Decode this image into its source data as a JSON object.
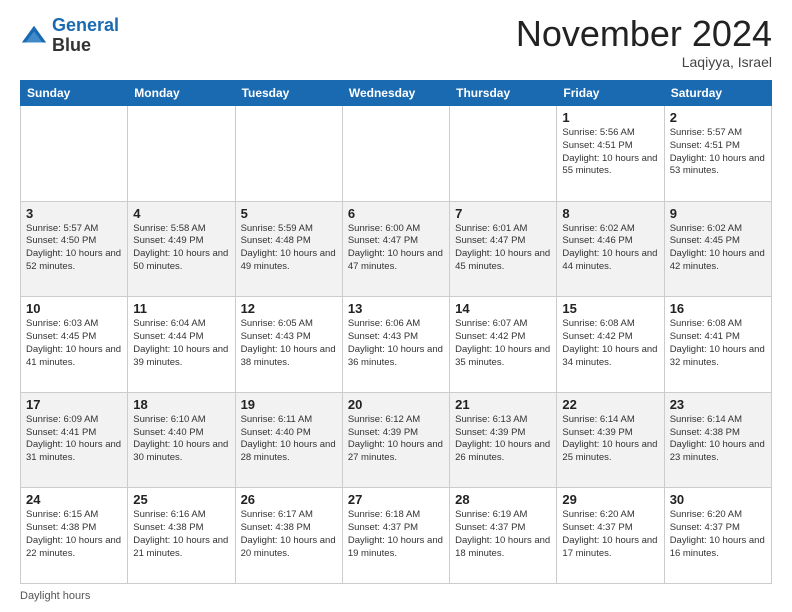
{
  "header": {
    "logo_line1": "General",
    "logo_line2": "Blue",
    "month": "November 2024",
    "location": "Laqiyya, Israel"
  },
  "footer": {
    "daylight_label": "Daylight hours"
  },
  "weekdays": [
    "Sunday",
    "Monday",
    "Tuesday",
    "Wednesday",
    "Thursday",
    "Friday",
    "Saturday"
  ],
  "weeks": [
    [
      {
        "day": "",
        "info": ""
      },
      {
        "day": "",
        "info": ""
      },
      {
        "day": "",
        "info": ""
      },
      {
        "day": "",
        "info": ""
      },
      {
        "day": "",
        "info": ""
      },
      {
        "day": "1",
        "info": "Sunrise: 5:56 AM\nSunset: 4:51 PM\nDaylight: 10 hours\nand 55 minutes."
      },
      {
        "day": "2",
        "info": "Sunrise: 5:57 AM\nSunset: 4:51 PM\nDaylight: 10 hours\nand 53 minutes."
      }
    ],
    [
      {
        "day": "3",
        "info": "Sunrise: 5:57 AM\nSunset: 4:50 PM\nDaylight: 10 hours\nand 52 minutes."
      },
      {
        "day": "4",
        "info": "Sunrise: 5:58 AM\nSunset: 4:49 PM\nDaylight: 10 hours\nand 50 minutes."
      },
      {
        "day": "5",
        "info": "Sunrise: 5:59 AM\nSunset: 4:48 PM\nDaylight: 10 hours\nand 49 minutes."
      },
      {
        "day": "6",
        "info": "Sunrise: 6:00 AM\nSunset: 4:47 PM\nDaylight: 10 hours\nand 47 minutes."
      },
      {
        "day": "7",
        "info": "Sunrise: 6:01 AM\nSunset: 4:47 PM\nDaylight: 10 hours\nand 45 minutes."
      },
      {
        "day": "8",
        "info": "Sunrise: 6:02 AM\nSunset: 4:46 PM\nDaylight: 10 hours\nand 44 minutes."
      },
      {
        "day": "9",
        "info": "Sunrise: 6:02 AM\nSunset: 4:45 PM\nDaylight: 10 hours\nand 42 minutes."
      }
    ],
    [
      {
        "day": "10",
        "info": "Sunrise: 6:03 AM\nSunset: 4:45 PM\nDaylight: 10 hours\nand 41 minutes."
      },
      {
        "day": "11",
        "info": "Sunrise: 6:04 AM\nSunset: 4:44 PM\nDaylight: 10 hours\nand 39 minutes."
      },
      {
        "day": "12",
        "info": "Sunrise: 6:05 AM\nSunset: 4:43 PM\nDaylight: 10 hours\nand 38 minutes."
      },
      {
        "day": "13",
        "info": "Sunrise: 6:06 AM\nSunset: 4:43 PM\nDaylight: 10 hours\nand 36 minutes."
      },
      {
        "day": "14",
        "info": "Sunrise: 6:07 AM\nSunset: 4:42 PM\nDaylight: 10 hours\nand 35 minutes."
      },
      {
        "day": "15",
        "info": "Sunrise: 6:08 AM\nSunset: 4:42 PM\nDaylight: 10 hours\nand 34 minutes."
      },
      {
        "day": "16",
        "info": "Sunrise: 6:08 AM\nSunset: 4:41 PM\nDaylight: 10 hours\nand 32 minutes."
      }
    ],
    [
      {
        "day": "17",
        "info": "Sunrise: 6:09 AM\nSunset: 4:41 PM\nDaylight: 10 hours\nand 31 minutes."
      },
      {
        "day": "18",
        "info": "Sunrise: 6:10 AM\nSunset: 4:40 PM\nDaylight: 10 hours\nand 30 minutes."
      },
      {
        "day": "19",
        "info": "Sunrise: 6:11 AM\nSunset: 4:40 PM\nDaylight: 10 hours\nand 28 minutes."
      },
      {
        "day": "20",
        "info": "Sunrise: 6:12 AM\nSunset: 4:39 PM\nDaylight: 10 hours\nand 27 minutes."
      },
      {
        "day": "21",
        "info": "Sunrise: 6:13 AM\nSunset: 4:39 PM\nDaylight: 10 hours\nand 26 minutes."
      },
      {
        "day": "22",
        "info": "Sunrise: 6:14 AM\nSunset: 4:39 PM\nDaylight: 10 hours\nand 25 minutes."
      },
      {
        "day": "23",
        "info": "Sunrise: 6:14 AM\nSunset: 4:38 PM\nDaylight: 10 hours\nand 23 minutes."
      }
    ],
    [
      {
        "day": "24",
        "info": "Sunrise: 6:15 AM\nSunset: 4:38 PM\nDaylight: 10 hours\nand 22 minutes."
      },
      {
        "day": "25",
        "info": "Sunrise: 6:16 AM\nSunset: 4:38 PM\nDaylight: 10 hours\nand 21 minutes."
      },
      {
        "day": "26",
        "info": "Sunrise: 6:17 AM\nSunset: 4:38 PM\nDaylight: 10 hours\nand 20 minutes."
      },
      {
        "day": "27",
        "info": "Sunrise: 6:18 AM\nSunset: 4:37 PM\nDaylight: 10 hours\nand 19 minutes."
      },
      {
        "day": "28",
        "info": "Sunrise: 6:19 AM\nSunset: 4:37 PM\nDaylight: 10 hours\nand 18 minutes."
      },
      {
        "day": "29",
        "info": "Sunrise: 6:20 AM\nSunset: 4:37 PM\nDaylight: 10 hours\nand 17 minutes."
      },
      {
        "day": "30",
        "info": "Sunrise: 6:20 AM\nSunset: 4:37 PM\nDaylight: 10 hours\nand 16 minutes."
      }
    ]
  ]
}
